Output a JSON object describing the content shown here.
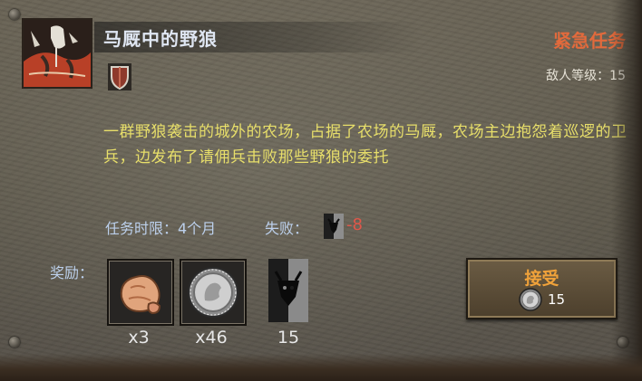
{
  "mission": {
    "title": "马厩中的野狼",
    "type": "紧急任务",
    "enemy_level_label": "敌人等级：",
    "enemy_level": "15",
    "description": "一群野狼袭击的城外的农场，占据了农场的马厩，农场主边抱怨着巡逻的卫兵，边发布了请佣兵击败那些野狼的委托",
    "duration": "任务时限：4个月",
    "fail_label": "失败：",
    "fail_value": "-8",
    "rewards_label": "奖励：",
    "rewards": [
      {
        "icon": "ore-icon",
        "quantity": "x3"
      },
      {
        "icon": "silver-coin-icon",
        "quantity": "x46"
      },
      {
        "icon": "reputation-banner-icon",
        "quantity": "15"
      }
    ],
    "accept": {
      "label": "接受",
      "cost": "15",
      "cost_icon": "silver-coin-icon"
    }
  },
  "colors": {
    "title": "#dfe6f2",
    "urgent": "#e26a3c",
    "description": "#e8df6a",
    "label": "#bcd0ec",
    "penalty": "#e0574a",
    "accept": "#f0a23a"
  }
}
